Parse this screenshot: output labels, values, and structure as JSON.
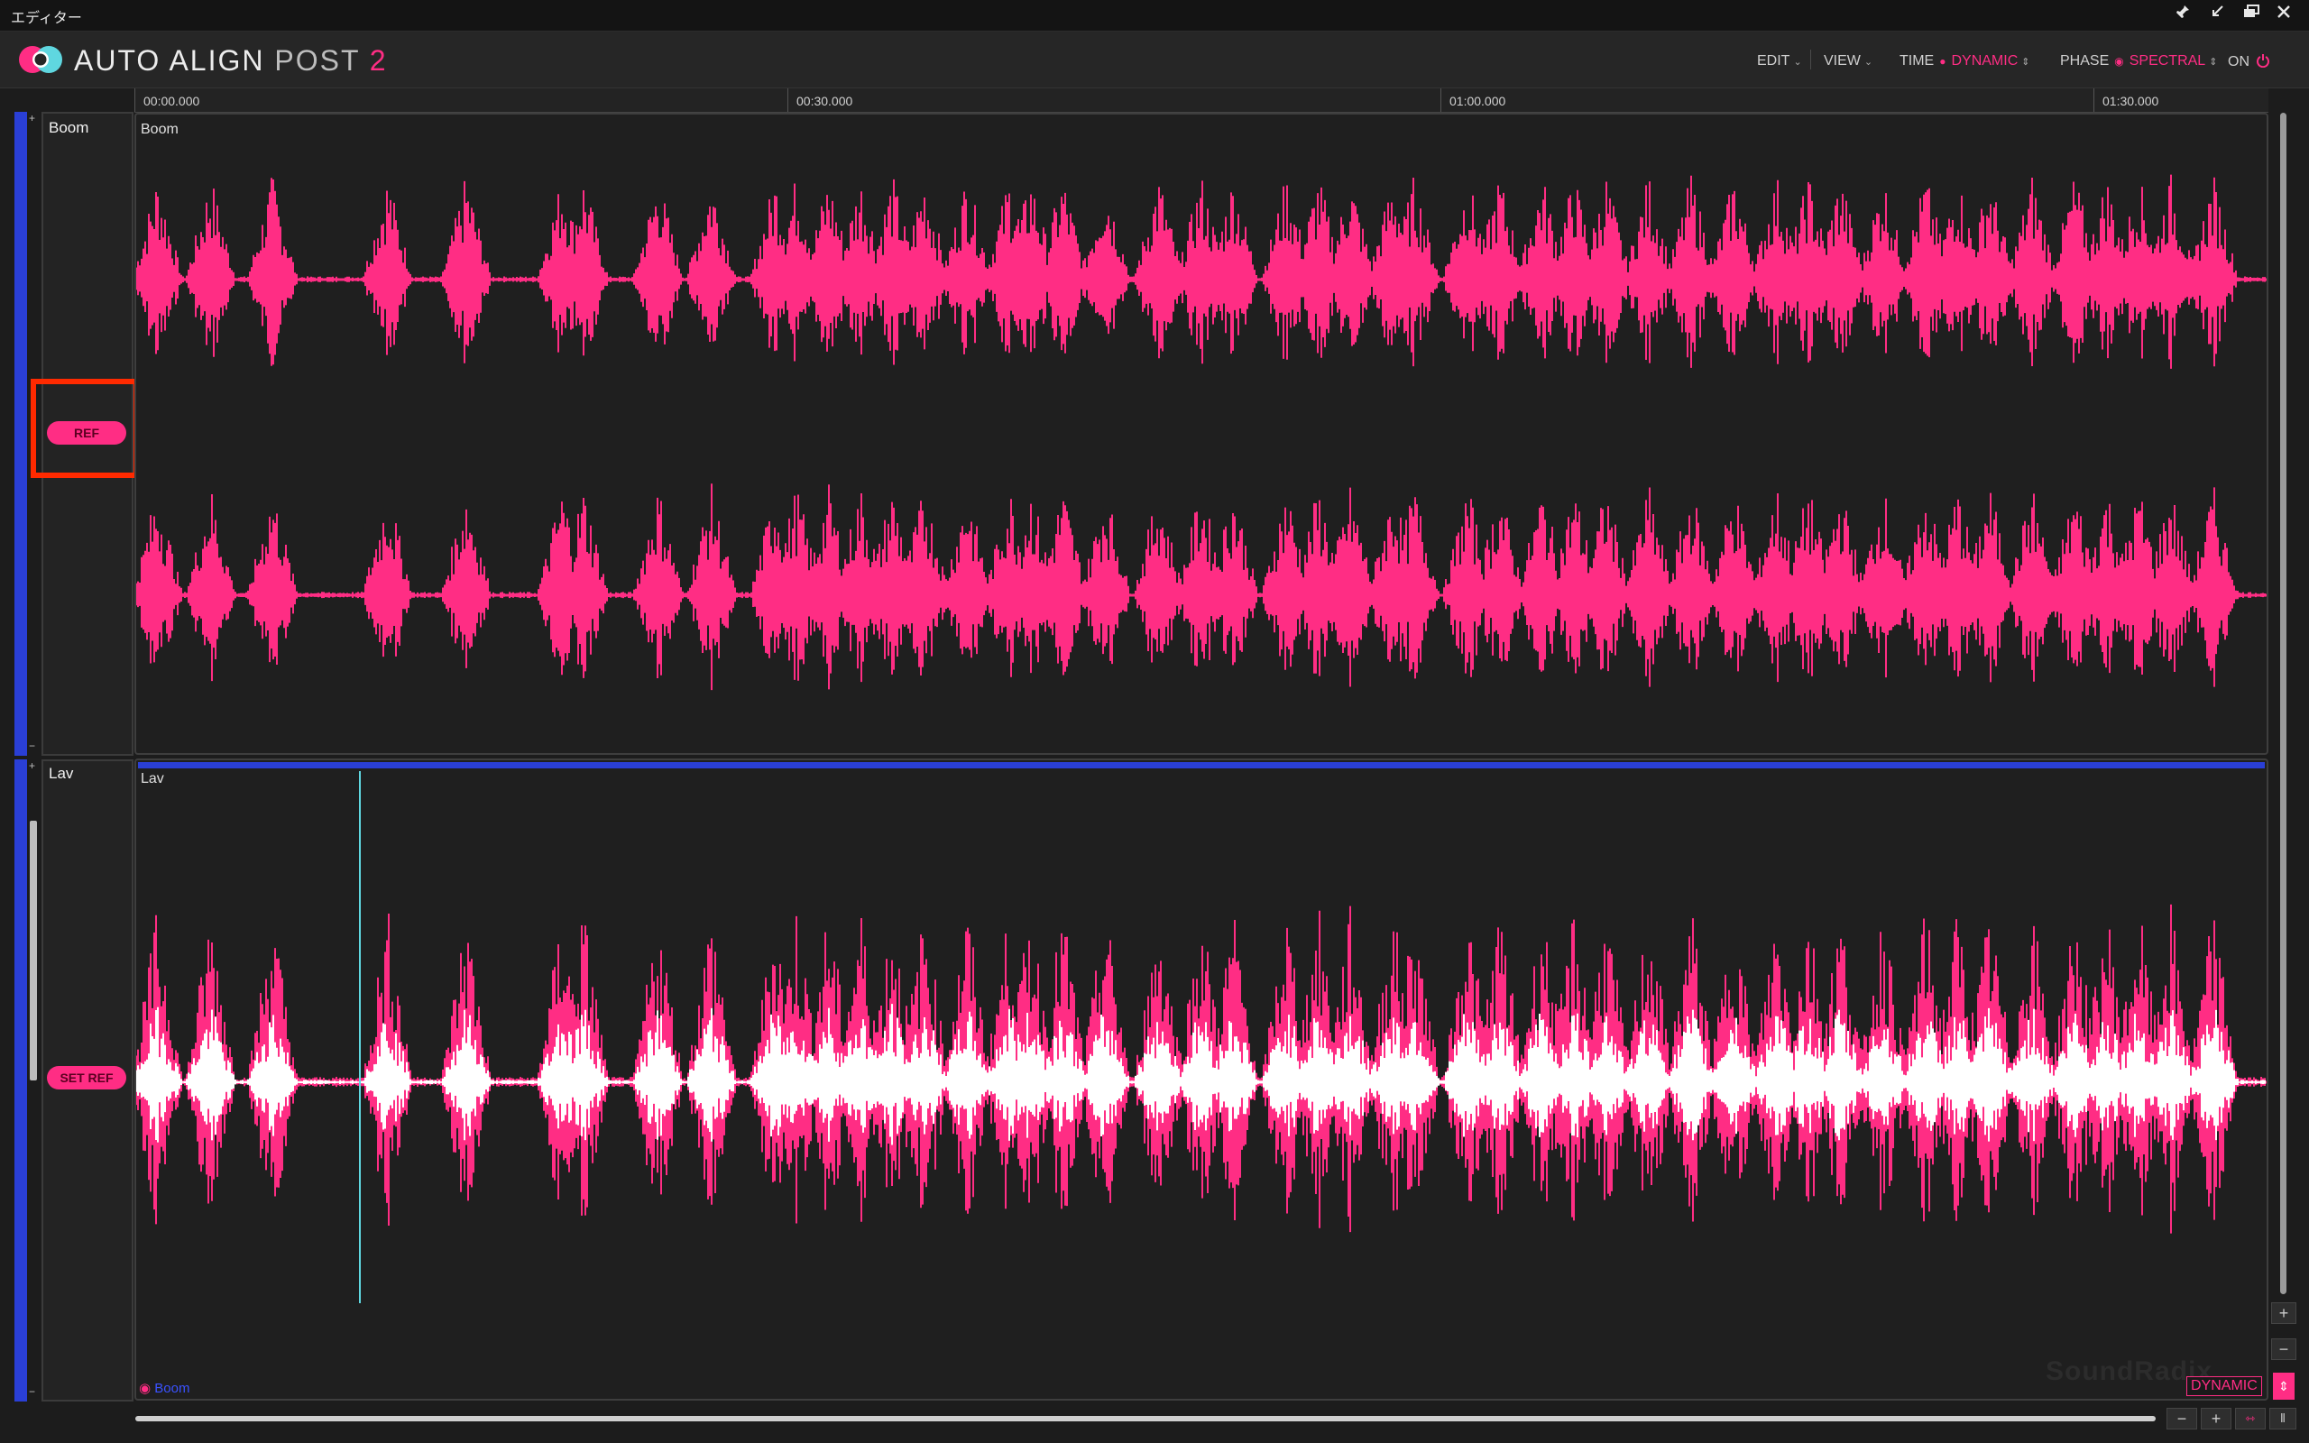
{
  "window": {
    "title": "エディター"
  },
  "window_controls": [
    "pin-icon",
    "shrink-icon",
    "restore-icon",
    "close-icon"
  ],
  "app": {
    "brand_a": "AUTO ALIGN",
    "brand_b": "POST",
    "brand_c": "2"
  },
  "menu": {
    "edit": "EDIT",
    "view": "VIEW",
    "time_label": "TIME",
    "time_value": "DYNAMIC",
    "phase_label": "PHASE",
    "phase_value": "SPECTRAL",
    "power": "ON"
  },
  "ruler": {
    "labels": [
      "00:00.000",
      "00:30.000",
      "01:00.000",
      "01:30.000"
    ]
  },
  "tracks": [
    {
      "name": "Boom",
      "button": "REF",
      "wave_label": "Boom"
    },
    {
      "name": "Lav",
      "button": "SET REF",
      "wave_label": "Lav"
    }
  ],
  "footer": {
    "reference_track": "Boom",
    "mode_badge": "DYNAMIC",
    "watermark": "SoundRadix"
  },
  "zoom_controls": {
    "minus": "−",
    "plus": "+"
  },
  "colors": {
    "accent": "#ff2d84",
    "strip": "#2a3fd6",
    "aligned_overlay": "#ffffff",
    "original_overlay": "#5fd7e0",
    "highlight": "#ff2a00"
  }
}
